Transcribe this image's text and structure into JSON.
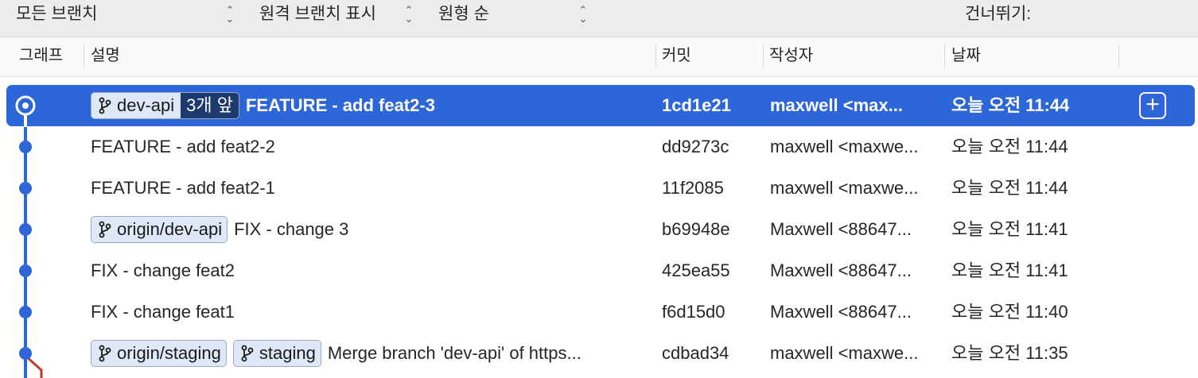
{
  "filters": {
    "branches": "모든 브랜치",
    "remote": "원격 브랜치 표시",
    "order": "원형 순",
    "skip": "건너뛰기:"
  },
  "columns": {
    "graph": "그래프",
    "description": "설명",
    "commit": "커밋",
    "author": "작성자",
    "date": "날짜"
  },
  "colors": {
    "accent": "#2c66d9",
    "graph_line": "#2c66d9",
    "merge_line": "#c0392b"
  },
  "rows": [
    {
      "tags": [
        {
          "label": "dev-api",
          "ahead": "3개 앞"
        }
      ],
      "message": "FEATURE - add feat2-3",
      "commit": "1cd1e21",
      "author": "maxwell <max...",
      "date": "오늘 오전 11:44",
      "selected": true
    },
    {
      "tags": [],
      "message": "FEATURE - add feat2-2",
      "commit": "dd9273c",
      "author": "maxwell <maxwe...",
      "date": "오늘 오전 11:44"
    },
    {
      "tags": [],
      "message": "FEATURE - add feat2-1",
      "commit": "11f2085",
      "author": "maxwell <maxwe...",
      "date": "오늘 오전 11:44"
    },
    {
      "tags": [
        {
          "label": "origin/dev-api"
        }
      ],
      "message": "FIX - change 3",
      "commit": "b69948e",
      "author": "Maxwell <88647...",
      "date": "오늘 오전 11:41"
    },
    {
      "tags": [],
      "message": "FIX - change feat2",
      "commit": "425ea55",
      "author": "Maxwell <88647...",
      "date": "오늘 오전 11:41"
    },
    {
      "tags": [],
      "message": "FIX - change feat1",
      "commit": "f6d15d0",
      "author": "Maxwell <88647...",
      "date": "오늘 오전 11:40"
    },
    {
      "tags": [
        {
          "label": "origin/staging"
        },
        {
          "label": "staging"
        }
      ],
      "message": "Merge branch 'dev-api' of https...",
      "commit": "cdbad34",
      "author": "maxwell <maxwe...",
      "date": "오늘 오전 11:35"
    }
  ]
}
